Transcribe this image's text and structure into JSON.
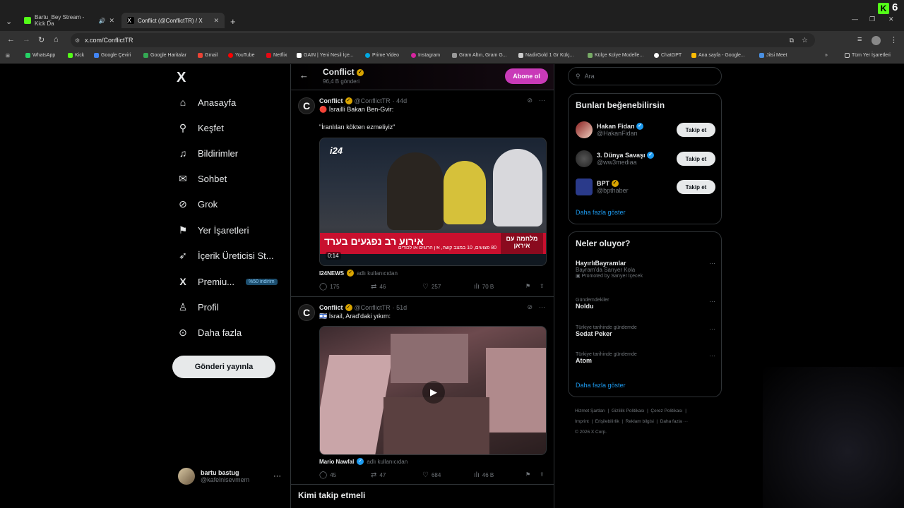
{
  "browser": {
    "tabs": [
      {
        "title": "Bartu_Bey Stream - Kick Da",
        "active": false
      },
      {
        "title": "Conflict (@ConflictTR) / X",
        "active": true
      }
    ],
    "url": "x.com/ConflictTR",
    "bookmarks": [
      "WhatsApp",
      "Kick",
      "Google Çeviri",
      "Google Haritalar",
      "Gmail",
      "YouTube",
      "Netflix",
      "GAIN | Yeni Nesil İçe...",
      "Prime Video",
      "Instagram",
      "Gram Altın, Gram G...",
      "NadirGold 1 Gr Külç...",
      "Külçe Kolye Modelle...",
      "ChatGPT",
      "Ana sayfa - Google...",
      "Jitsi Meet"
    ],
    "all_bookmarks": "Tüm Yer İşaretleri"
  },
  "overlay": {
    "kick_letter": "K",
    "kick_number": "6"
  },
  "sidebar": {
    "logo": "X",
    "items": [
      {
        "label": "Anasayfa",
        "icon": "home-icon",
        "glyph": "⌂"
      },
      {
        "label": "Keşfet",
        "icon": "search-icon",
        "glyph": "⚲"
      },
      {
        "label": "Bildirimler",
        "icon": "bell-icon",
        "glyph": "♫"
      },
      {
        "label": "Sohbet",
        "icon": "mail-icon",
        "glyph": "✉"
      },
      {
        "label": "Grok",
        "icon": "grok-icon",
        "glyph": "⊘"
      },
      {
        "label": "Yer İşaretleri",
        "icon": "bookmark-icon",
        "glyph": "⚑"
      },
      {
        "label": "İçerik Üreticisi St...",
        "icon": "rocket-icon",
        "glyph": "➶"
      },
      {
        "label": "Premiu...",
        "icon": "x-premium-icon",
        "glyph": "X"
      },
      {
        "label": "Profil",
        "icon": "person-icon",
        "glyph": "♙"
      },
      {
        "label": "Daha fazla",
        "icon": "more-circle-icon",
        "glyph": "⊙"
      }
    ],
    "premium_badge": "%50 indirim",
    "post_button": "Gönderi yayınla",
    "me": {
      "name": "bartu bastug",
      "handle": "@kafelnisevmem"
    }
  },
  "profile_header": {
    "name": "Conflict",
    "posts": "96,4 B gönderi",
    "subscribe": "Abone ol"
  },
  "tweets": [
    {
      "name": "Conflict",
      "handle": "@ConflictTR",
      "time": "· 44d",
      "line1": "🔴 İsrailli Bakan Ben-Gvir:",
      "line2": "\"İranlıları kökten ezmeliyiz\"",
      "media_logo": "i24",
      "banner_main": "אירוע רב נפגעים בערד",
      "banner_sub": "80 פצועים, 10 במצב קשה, אין הרוגים או לכודים",
      "banner_side": "מלחמה עם איראן",
      "timer": "0:14",
      "credit": "I24NEWS",
      "credit_sub": "adlı kullanıcıdan",
      "replies": "175",
      "reposts": "46",
      "likes": "257",
      "views": "70 B"
    },
    {
      "name": "Conflict",
      "handle": "@ConflictTR",
      "time": "· 51d",
      "line1": "🇮🇱 İsrail, Arad'daki yıkım:",
      "credit": "Mario Nawfal",
      "credit_sub": "adlı kullanıcıdan",
      "replies": "45",
      "reposts": "47",
      "likes": "684",
      "views": "46 B"
    }
  ],
  "follow_section_title": "Kimi takip etmeli",
  "right": {
    "search_placeholder": "Ara",
    "who_title": "Bunları beğenebilirsin",
    "who": [
      {
        "name": "Hakan Fidan",
        "handle": "@HakanFidan",
        "badge": "blue",
        "btn": "Takip et"
      },
      {
        "name": "3. Dünya Savaşı",
        "handle": "@ww3mediaa",
        "badge": "blue",
        "btn": "Takip et"
      },
      {
        "name": "BPT",
        "handle": "@bpthaber",
        "badge": "gold",
        "btn": "Takip et"
      }
    ],
    "who_more": "Daha fazla göster",
    "trends_title": "Neler oluyor?",
    "trends": [
      {
        "ctx": "",
        "name": "HayırlıBayramlar",
        "sub": "Bayram'da Sarıyer Kola",
        "promo": "Promoted by Sarıyer İçecek"
      },
      {
        "ctx": "Gündemdekiler",
        "name": "Noldu",
        "sub": "",
        "promo": ""
      },
      {
        "ctx": "Türkiye tarihinde gündemde",
        "name": "Sedat Peker",
        "sub": "",
        "promo": ""
      },
      {
        "ctx": "Türkiye tarihinde gündemde",
        "name": "Atom",
        "sub": "",
        "promo": ""
      }
    ],
    "trends_more": "Daha fazla göster",
    "footer": [
      "Hizmet Şartları",
      "Gizlilik Politikası",
      "Çerez Politikası",
      "Imprint",
      "Erişilebilirlik",
      "Reklam bilgisi",
      "Daha fazla ···",
      "© 2026 X Corp."
    ]
  },
  "colors": {
    "accent": "#1d9bf0",
    "subscribe": "#c93ab8",
    "kick": "#53fc18"
  }
}
